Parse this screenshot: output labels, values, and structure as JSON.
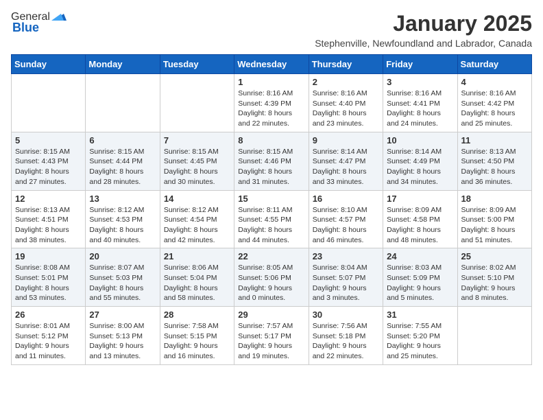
{
  "header": {
    "logo_general": "General",
    "logo_blue": "Blue",
    "month_title": "January 2025",
    "subtitle": "Stephenville, Newfoundland and Labrador, Canada"
  },
  "days_of_week": [
    "Sunday",
    "Monday",
    "Tuesday",
    "Wednesday",
    "Thursday",
    "Friday",
    "Saturday"
  ],
  "weeks": [
    [
      {
        "day": "",
        "info": ""
      },
      {
        "day": "",
        "info": ""
      },
      {
        "day": "",
        "info": ""
      },
      {
        "day": "1",
        "info": "Sunrise: 8:16 AM\nSunset: 4:39 PM\nDaylight: 8 hours\nand 22 minutes."
      },
      {
        "day": "2",
        "info": "Sunrise: 8:16 AM\nSunset: 4:40 PM\nDaylight: 8 hours\nand 23 minutes."
      },
      {
        "day": "3",
        "info": "Sunrise: 8:16 AM\nSunset: 4:41 PM\nDaylight: 8 hours\nand 24 minutes."
      },
      {
        "day": "4",
        "info": "Sunrise: 8:16 AM\nSunset: 4:42 PM\nDaylight: 8 hours\nand 25 minutes."
      }
    ],
    [
      {
        "day": "5",
        "info": "Sunrise: 8:15 AM\nSunset: 4:43 PM\nDaylight: 8 hours\nand 27 minutes."
      },
      {
        "day": "6",
        "info": "Sunrise: 8:15 AM\nSunset: 4:44 PM\nDaylight: 8 hours\nand 28 minutes."
      },
      {
        "day": "7",
        "info": "Sunrise: 8:15 AM\nSunset: 4:45 PM\nDaylight: 8 hours\nand 30 minutes."
      },
      {
        "day": "8",
        "info": "Sunrise: 8:15 AM\nSunset: 4:46 PM\nDaylight: 8 hours\nand 31 minutes."
      },
      {
        "day": "9",
        "info": "Sunrise: 8:14 AM\nSunset: 4:47 PM\nDaylight: 8 hours\nand 33 minutes."
      },
      {
        "day": "10",
        "info": "Sunrise: 8:14 AM\nSunset: 4:49 PM\nDaylight: 8 hours\nand 34 minutes."
      },
      {
        "day": "11",
        "info": "Sunrise: 8:13 AM\nSunset: 4:50 PM\nDaylight: 8 hours\nand 36 minutes."
      }
    ],
    [
      {
        "day": "12",
        "info": "Sunrise: 8:13 AM\nSunset: 4:51 PM\nDaylight: 8 hours\nand 38 minutes."
      },
      {
        "day": "13",
        "info": "Sunrise: 8:12 AM\nSunset: 4:53 PM\nDaylight: 8 hours\nand 40 minutes."
      },
      {
        "day": "14",
        "info": "Sunrise: 8:12 AM\nSunset: 4:54 PM\nDaylight: 8 hours\nand 42 minutes."
      },
      {
        "day": "15",
        "info": "Sunrise: 8:11 AM\nSunset: 4:55 PM\nDaylight: 8 hours\nand 44 minutes."
      },
      {
        "day": "16",
        "info": "Sunrise: 8:10 AM\nSunset: 4:57 PM\nDaylight: 8 hours\nand 46 minutes."
      },
      {
        "day": "17",
        "info": "Sunrise: 8:09 AM\nSunset: 4:58 PM\nDaylight: 8 hours\nand 48 minutes."
      },
      {
        "day": "18",
        "info": "Sunrise: 8:09 AM\nSunset: 5:00 PM\nDaylight: 8 hours\nand 51 minutes."
      }
    ],
    [
      {
        "day": "19",
        "info": "Sunrise: 8:08 AM\nSunset: 5:01 PM\nDaylight: 8 hours\nand 53 minutes."
      },
      {
        "day": "20",
        "info": "Sunrise: 8:07 AM\nSunset: 5:03 PM\nDaylight: 8 hours\nand 55 minutes."
      },
      {
        "day": "21",
        "info": "Sunrise: 8:06 AM\nSunset: 5:04 PM\nDaylight: 8 hours\nand 58 minutes."
      },
      {
        "day": "22",
        "info": "Sunrise: 8:05 AM\nSunset: 5:06 PM\nDaylight: 9 hours\nand 0 minutes."
      },
      {
        "day": "23",
        "info": "Sunrise: 8:04 AM\nSunset: 5:07 PM\nDaylight: 9 hours\nand 3 minutes."
      },
      {
        "day": "24",
        "info": "Sunrise: 8:03 AM\nSunset: 5:09 PM\nDaylight: 9 hours\nand 5 minutes."
      },
      {
        "day": "25",
        "info": "Sunrise: 8:02 AM\nSunset: 5:10 PM\nDaylight: 9 hours\nand 8 minutes."
      }
    ],
    [
      {
        "day": "26",
        "info": "Sunrise: 8:01 AM\nSunset: 5:12 PM\nDaylight: 9 hours\nand 11 minutes."
      },
      {
        "day": "27",
        "info": "Sunrise: 8:00 AM\nSunset: 5:13 PM\nDaylight: 9 hours\nand 13 minutes."
      },
      {
        "day": "28",
        "info": "Sunrise: 7:58 AM\nSunset: 5:15 PM\nDaylight: 9 hours\nand 16 minutes."
      },
      {
        "day": "29",
        "info": "Sunrise: 7:57 AM\nSunset: 5:17 PM\nDaylight: 9 hours\nand 19 minutes."
      },
      {
        "day": "30",
        "info": "Sunrise: 7:56 AM\nSunset: 5:18 PM\nDaylight: 9 hours\nand 22 minutes."
      },
      {
        "day": "31",
        "info": "Sunrise: 7:55 AM\nSunset: 5:20 PM\nDaylight: 9 hours\nand 25 minutes."
      },
      {
        "day": "",
        "info": ""
      }
    ]
  ]
}
